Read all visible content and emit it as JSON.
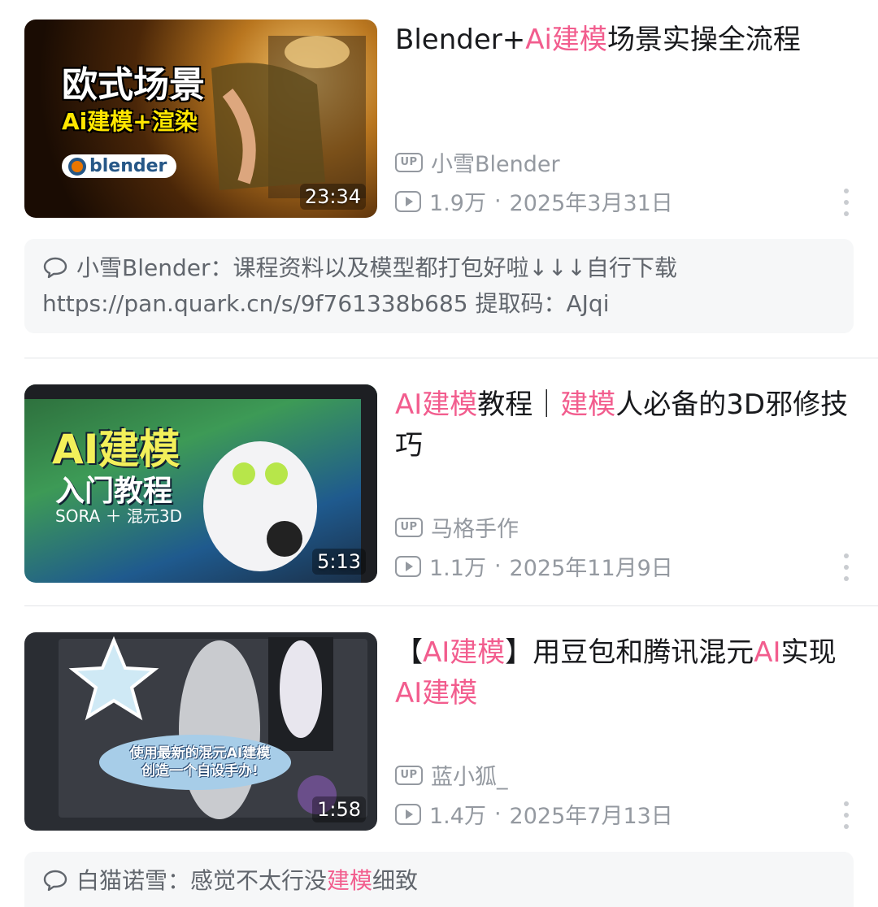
{
  "videos": [
    {
      "title_parts": [
        {
          "text": "Blender+",
          "hl": false
        },
        {
          "text": "Ai建模",
          "hl": true
        },
        {
          "text": "场景实操全流程",
          "hl": false
        }
      ],
      "thumb_text_1": "欧式场景",
      "thumb_text_2": "Ai建模+渲染",
      "thumb_logo": "blender",
      "duration": "23:34",
      "uploader": "小雪Blender",
      "views": "1.9万",
      "date": "2025年3月31日",
      "comment": {
        "user": "小雪Blender",
        "text": "：课程资料以及模型都打包好啦↓↓↓自行下载 https://pan.quark.cn/s/9f761338b685 提取码：AJqi"
      }
    },
    {
      "title_parts": [
        {
          "text": "AI建模",
          "hl": true
        },
        {
          "text": "教程｜",
          "hl": false
        },
        {
          "text": "建模",
          "hl": true
        },
        {
          "text": "人必备的3D邪修技巧",
          "hl": false
        }
      ],
      "thumb_text_1": "AI建模",
      "thumb_text_2": "入门教程",
      "thumb_text_3": "SORA ＋ 混元3D",
      "duration": "5:13",
      "uploader": "马格手作",
      "views": "1.1万",
      "date": "2025年11月9日"
    },
    {
      "title_parts": [
        {
          "text": "【",
          "hl": false
        },
        {
          "text": "AI建模",
          "hl": true
        },
        {
          "text": "】用豆包和腾讯混元",
          "hl": false
        },
        {
          "text": "AI",
          "hl": true
        },
        {
          "text": "实现",
          "hl": false
        },
        {
          "text": "AI建模",
          "hl": true
        }
      ],
      "thumb_text_1": "使用最新的混元AI建模",
      "thumb_text_2": "创造一个自设手办!",
      "duration": "1:58",
      "uploader": "蓝小狐_",
      "views": "1.4万",
      "date": "2025年7月13日",
      "comment": {
        "user": "白猫诺雪",
        "text_before": "：感觉不太行没",
        "text_hl": "建模",
        "text_after": "细致"
      }
    }
  ],
  "labels": {
    "up_badge": "UP",
    "separator": "·"
  },
  "colors": {
    "highlight": "#f25d8e",
    "meta": "#9499a0"
  }
}
